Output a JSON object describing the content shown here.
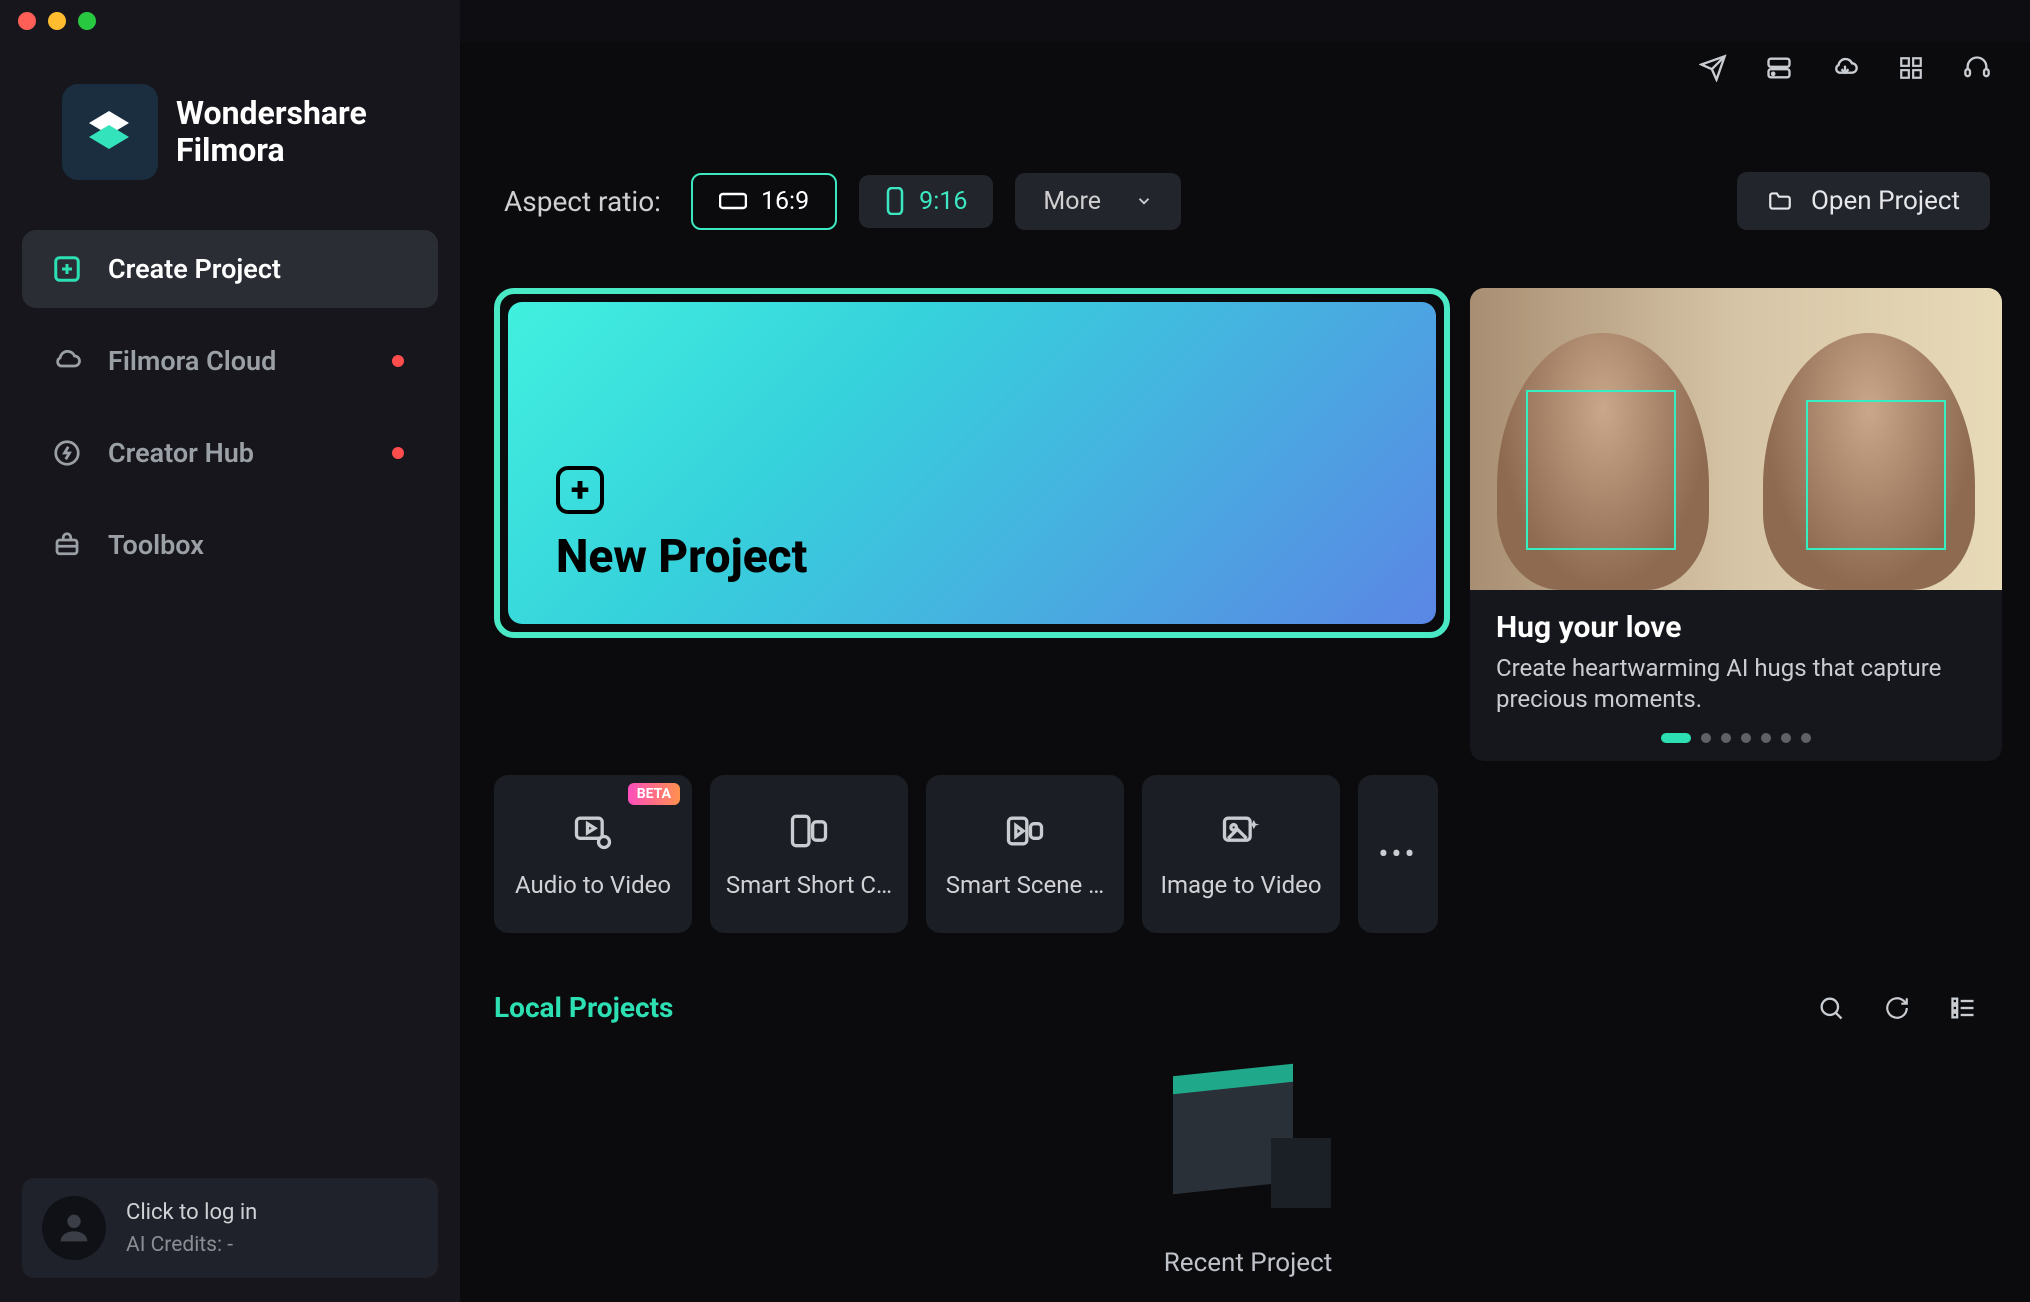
{
  "app": {
    "name_line1": "Wondershare",
    "name_line2": "Filmora"
  },
  "sidebar": {
    "items": [
      {
        "label": "Create Project",
        "active": true,
        "dot": false
      },
      {
        "label": "Filmora Cloud",
        "active": false,
        "dot": true
      },
      {
        "label": "Creator Hub",
        "active": false,
        "dot": true
      },
      {
        "label": "Toolbox",
        "active": false,
        "dot": false
      }
    ],
    "login": {
      "click": "Click to log in",
      "credits": "AI Credits: -"
    }
  },
  "ratio": {
    "label": "Aspect ratio:",
    "r169": "16:9",
    "r916": "9:16",
    "more": "More"
  },
  "open_project": "Open Project",
  "new_project": "New Project",
  "promo": {
    "title": "Hug your love",
    "desc": "Create heartwarming AI hugs that capture precious moments."
  },
  "tools": [
    {
      "label": "Audio to Video",
      "beta": "BETA"
    },
    {
      "label": "Smart Short C…",
      "beta": null
    },
    {
      "label": "Smart Scene …",
      "beta": null
    },
    {
      "label": "Image to Video",
      "beta": null
    }
  ],
  "local": {
    "title": "Local Projects",
    "empty": "Recent Project"
  }
}
